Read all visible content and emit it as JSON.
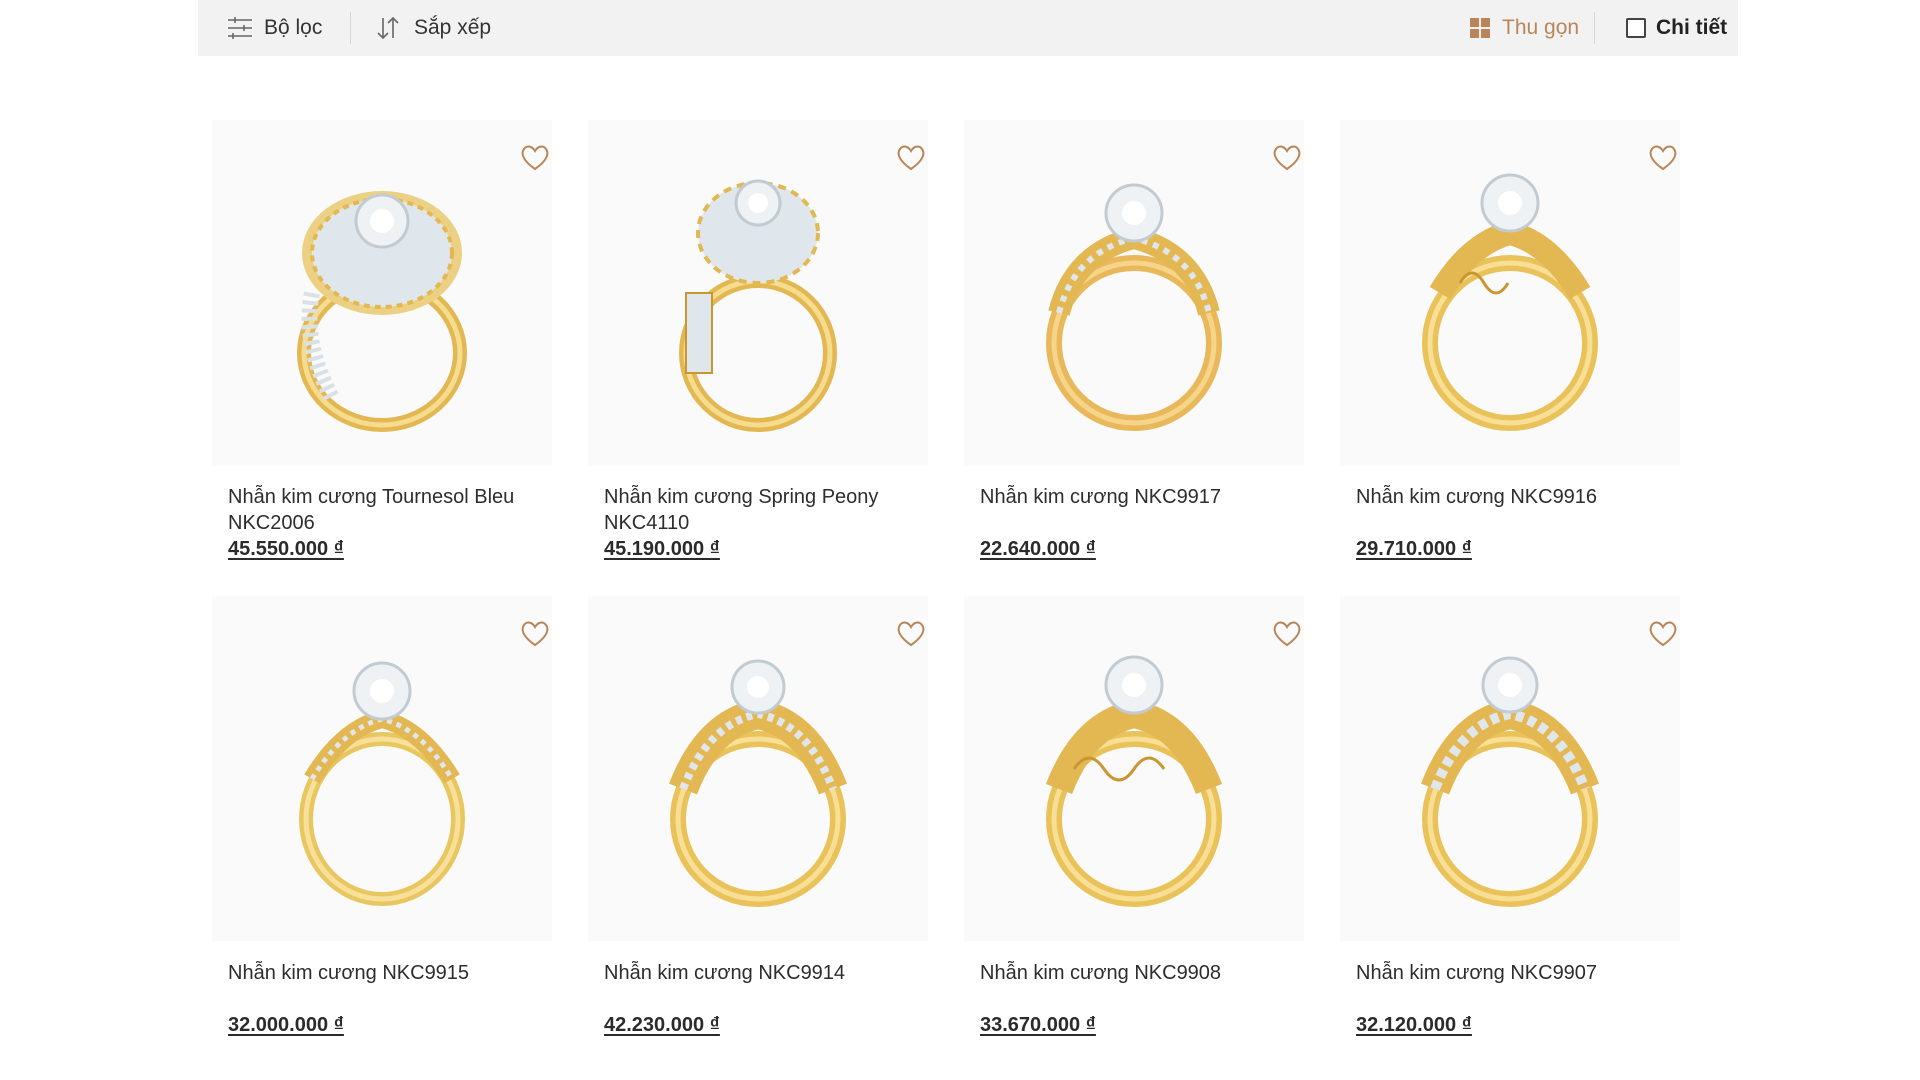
{
  "toolbar": {
    "filter_label": "Bộ lọc",
    "sort_label": "Sắp xếp",
    "compact_label": "Thu gọn",
    "detail_label": "Chi tiết",
    "compact_color": "#b9865a"
  },
  "products": [
    {
      "name": "Nhẫn kim cương Tournesol Bleu NKC2006",
      "price": "45.550.000 ₫"
    },
    {
      "name": "Nhẫn kim cương Spring Peony NKC4110",
      "price": "45.190.000 ₫"
    },
    {
      "name": "Nhẫn kim cương NKC9917",
      "price": "22.640.000 ₫"
    },
    {
      "name": "Nhẫn kim cương NKC9916",
      "price": "29.710.000 ₫"
    },
    {
      "name": "Nhẫn kim cương NKC9915",
      "price": "32.000.000 ₫"
    },
    {
      "name": "Nhẫn kim cương NKC9914",
      "price": "42.230.000 ₫"
    },
    {
      "name": "Nhẫn kim cương NKC9908",
      "price": "33.670.000 ₫"
    },
    {
      "name": "Nhẫn kim cương NKC9907",
      "price": "32.120.000 ₫"
    }
  ],
  "colors": {
    "gold": "#e9c46a",
    "gold_dark": "#c9962f",
    "diamond": "#dfe6ec",
    "heart": "#b9865a"
  }
}
